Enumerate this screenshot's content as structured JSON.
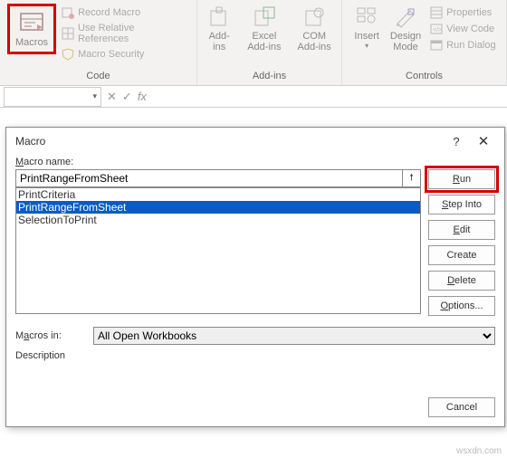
{
  "ribbon": {
    "code_group": {
      "label": "Code",
      "macros": "Macros",
      "record": "Record Macro",
      "relative": "Use Relative References",
      "security": "Macro Security"
    },
    "addins_group": {
      "label": "Add-ins",
      "addins": "Add-\nins",
      "excel": "Excel\nAdd-ins",
      "com": "COM\nAdd-ins"
    },
    "controls_group": {
      "label": "Controls",
      "insert": "Insert",
      "design": "Design\nMode",
      "props": "Properties",
      "viewcode": "View Code",
      "rundialog": "Run Dialog"
    }
  },
  "dialog": {
    "title": "Macro",
    "name_label": "Macro name:",
    "name_value": "PrintRangeFromSheet",
    "items": {
      "0": "PrintCriteria",
      "1": "PrintRangeFromSheet",
      "2": "SelectionToPrint"
    },
    "in_label": "Macros in:",
    "in_value": "All Open Workbooks",
    "desc_label": "Description",
    "buttons": {
      "run": "Run",
      "step": "Step Into",
      "edit": "Edit",
      "create": "Create",
      "delete": "Delete",
      "options": "Options...",
      "cancel": "Cancel"
    }
  },
  "watermark": "wsxdn.com"
}
